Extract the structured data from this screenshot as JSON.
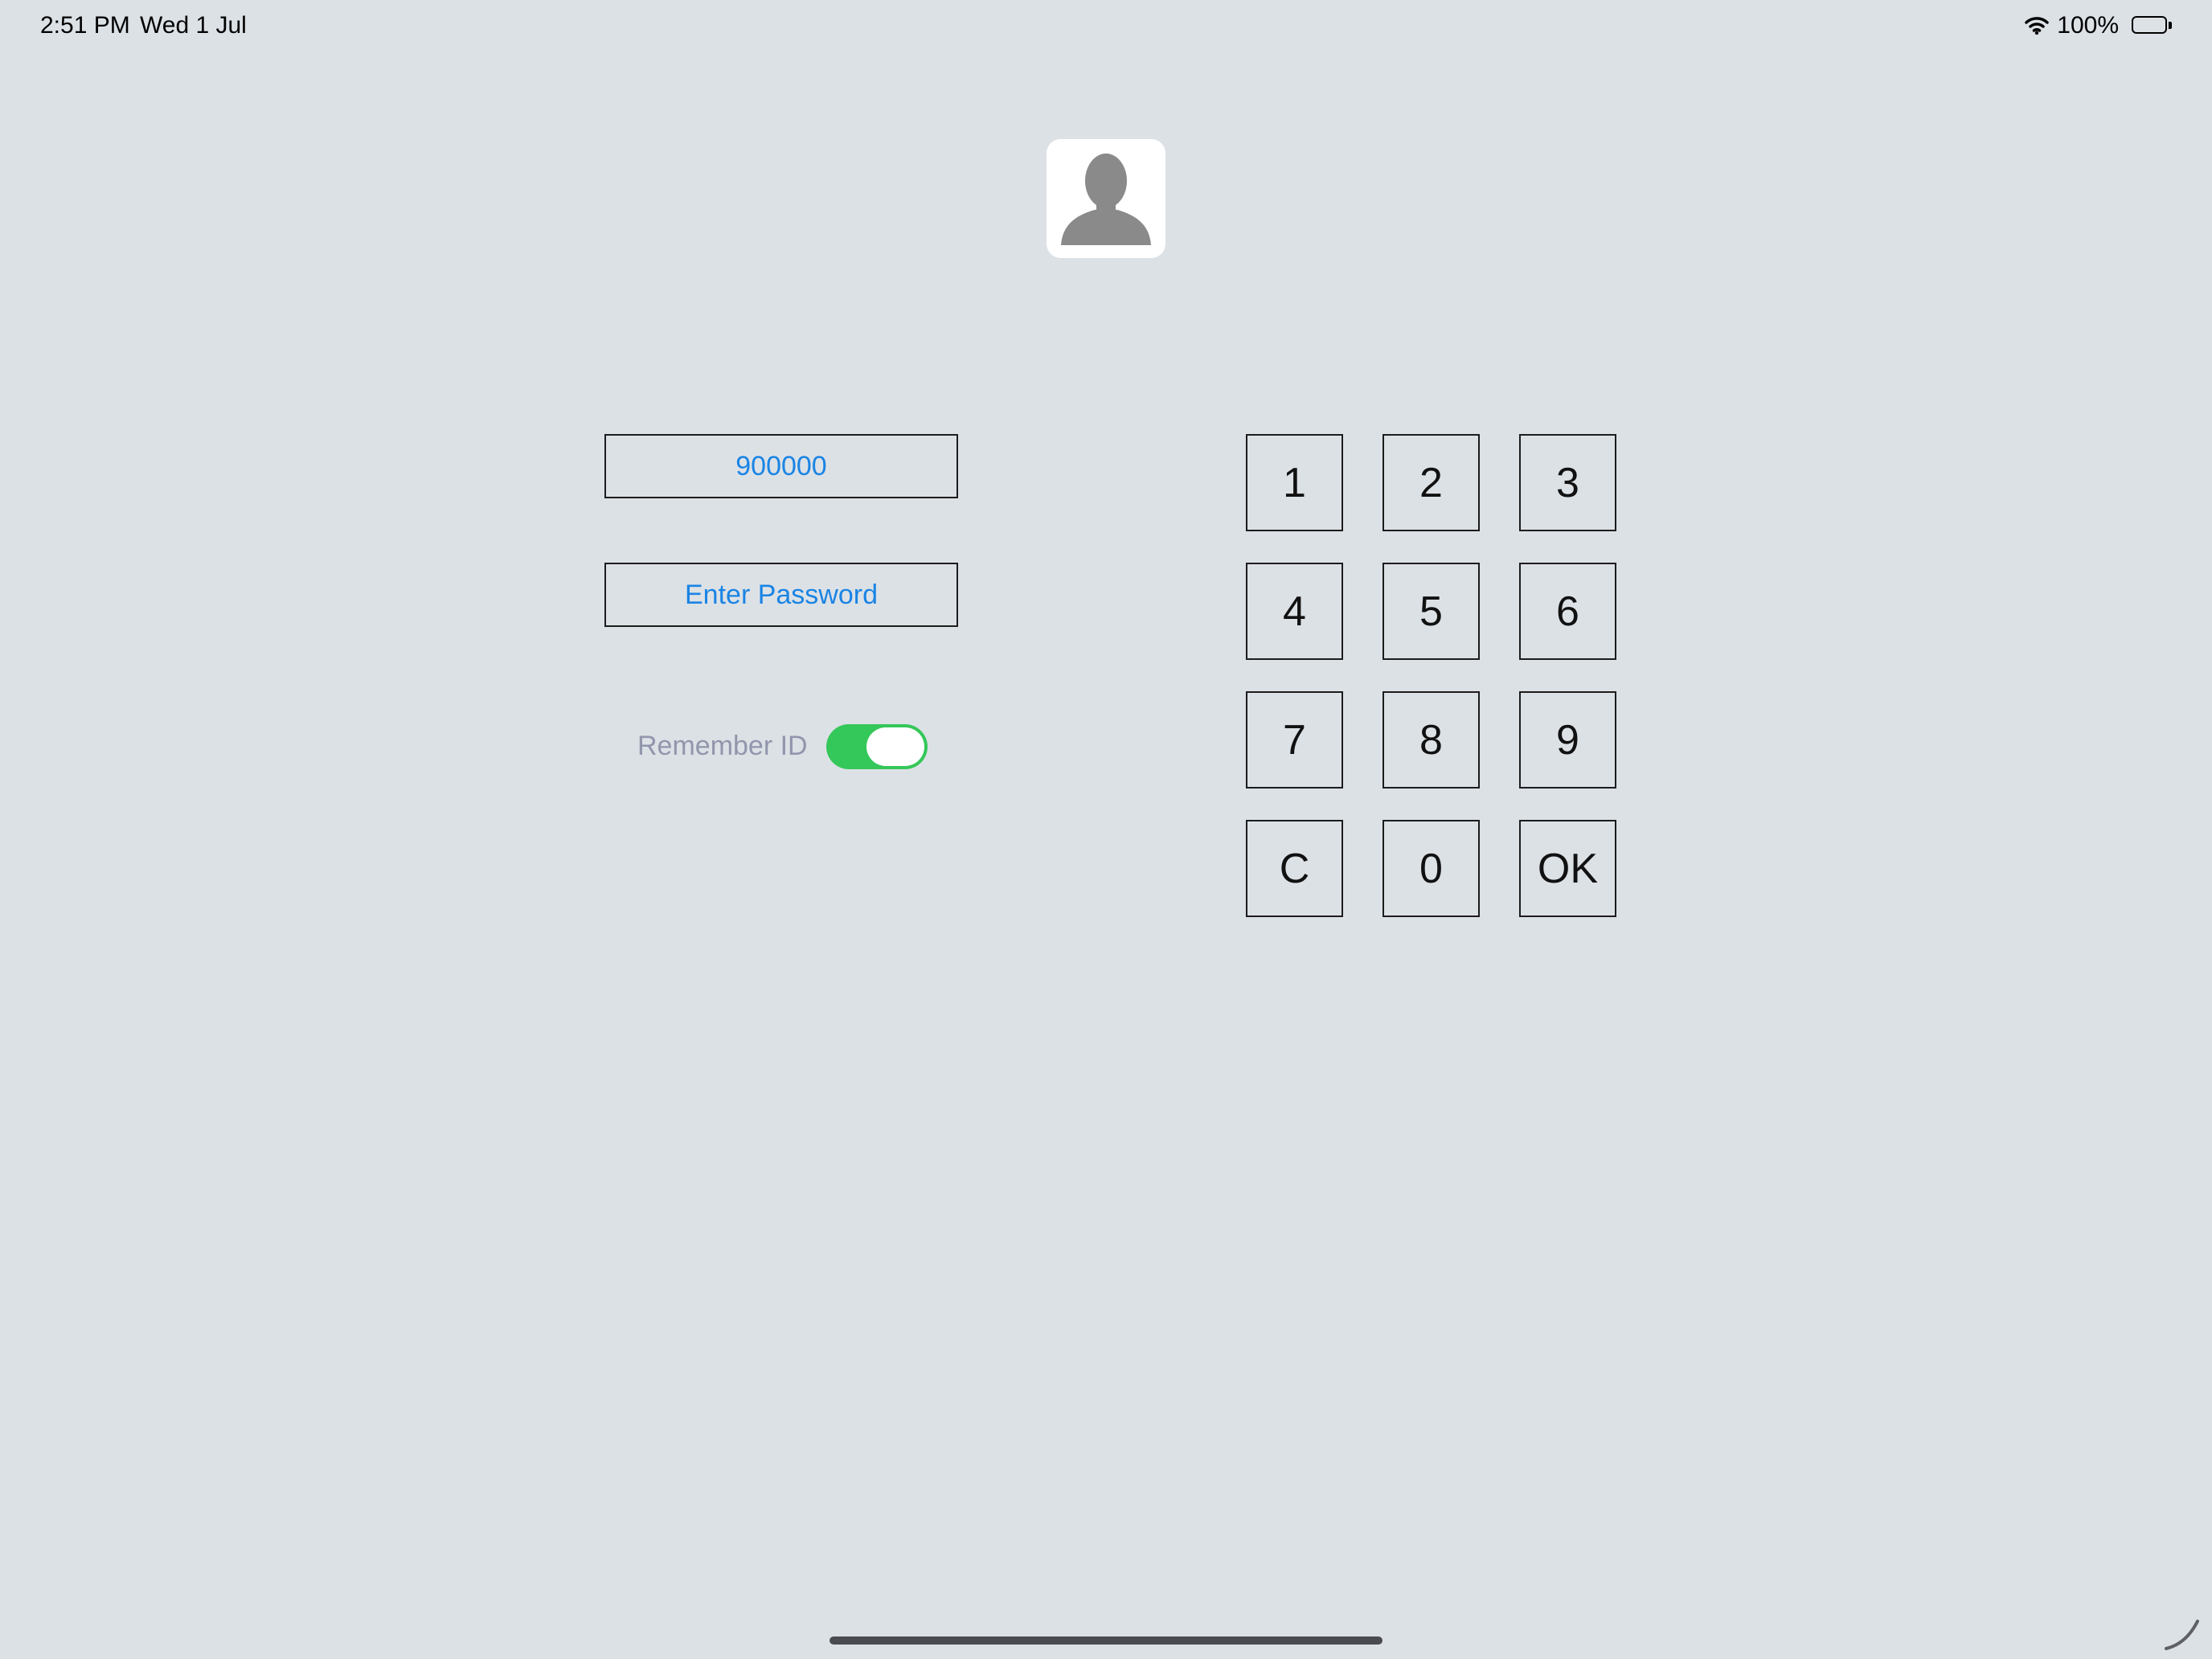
{
  "status_bar": {
    "time": "2:51 PM",
    "date": "Wed 1 Jul",
    "battery_percent": "100%",
    "wifi_icon": "wifi-icon",
    "battery_icon": "battery-icon"
  },
  "avatar": {
    "icon": "person-silhouette-icon"
  },
  "login_form": {
    "user_id_value": "900000",
    "password_placeholder": "Enter Password",
    "remember_id_label": "Remember ID",
    "remember_id_on": true
  },
  "keypad": {
    "keys": [
      "1",
      "2",
      "3",
      "4",
      "5",
      "6",
      "7",
      "8",
      "9",
      "C",
      "0",
      "OK"
    ]
  },
  "colors": {
    "background": "#dce1e6",
    "field_text": "#1a84e4",
    "toggle_on": "#34c759",
    "label_muted": "#9196ac"
  }
}
